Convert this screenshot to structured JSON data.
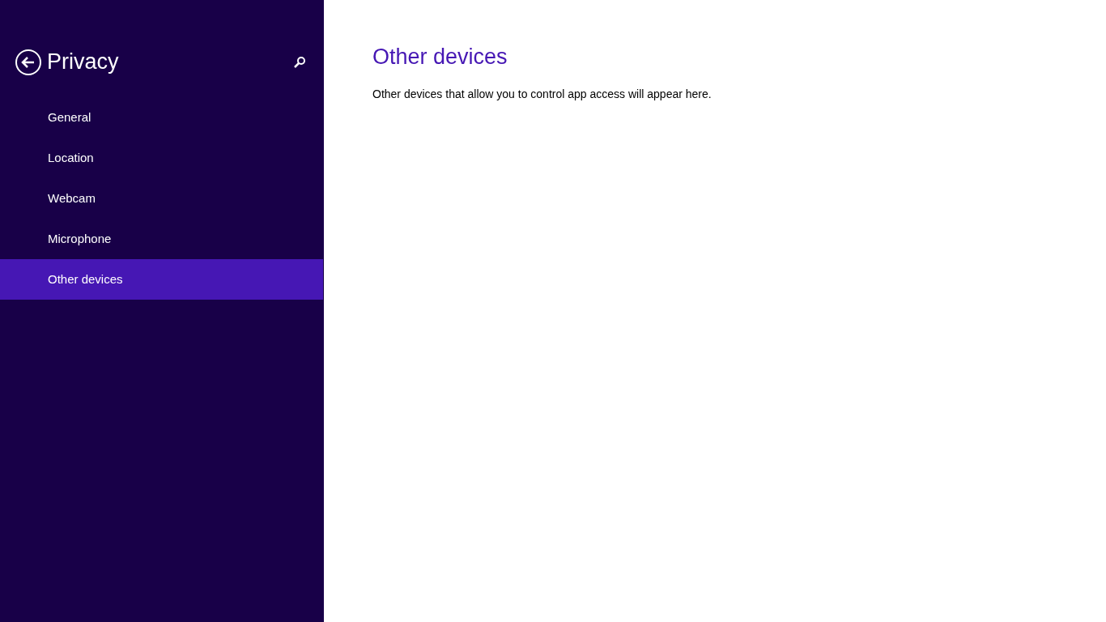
{
  "sidebar": {
    "title": "Privacy",
    "items": [
      {
        "label": "General",
        "selected": false
      },
      {
        "label": "Location",
        "selected": false
      },
      {
        "label": "Webcam",
        "selected": false
      },
      {
        "label": "Microphone",
        "selected": false
      },
      {
        "label": "Other devices",
        "selected": true
      }
    ]
  },
  "content": {
    "heading": "Other devices",
    "description": "Other devices that allow you to control app access will appear here."
  }
}
